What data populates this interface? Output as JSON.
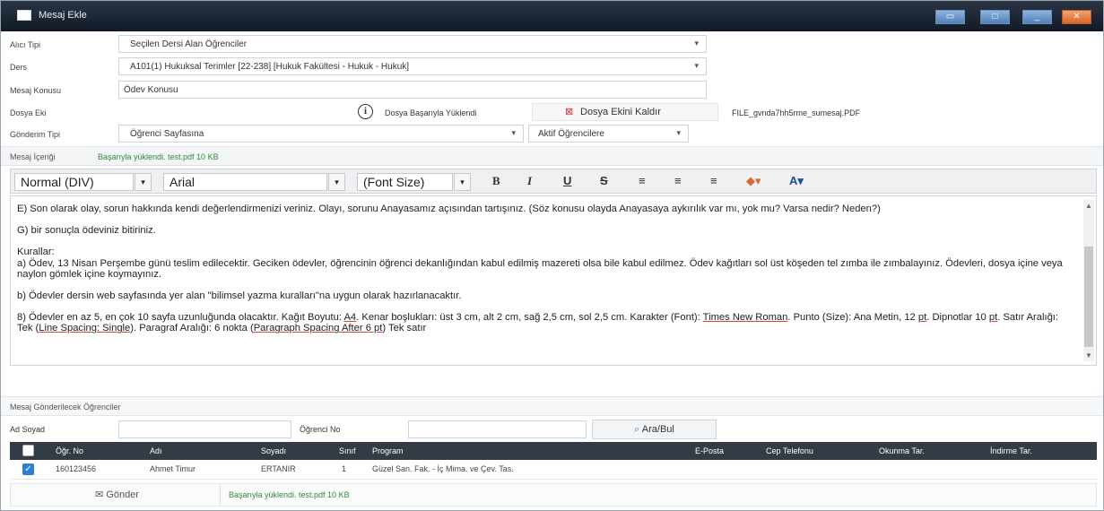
{
  "window": {
    "title": "Mesaj Ekle",
    "colors": {
      "titlebar": "#1b2533",
      "accent": "#2b7fd8",
      "success_text": "#2f8a3a",
      "grid_header": "#333b45"
    }
  },
  "form": {
    "alici_tipi": {
      "label": "Alıcı Tipi",
      "value": "Seçilen Dersi Alan Öğrenciler"
    },
    "ders": {
      "label": "Ders",
      "value": "A101(1) Hukuksal Terimler [22-238] [Hukuk Fakültesi - Hukuk - Hukuk]"
    },
    "konu": {
      "label": "Mesaj Konusu",
      "value": "Ödev Konusu"
    },
    "dosya": {
      "label": "Dosya Eki",
      "status": "Dosya Başarıyla Yüklendi",
      "remove_label": "Dosya Ekini Kaldır",
      "file_name": "FILE_gvnda7hh5rme_sumesaj.PDF"
    },
    "gonderim": {
      "label": "Gönderim Tipi",
      "value": "Öğrenci Sayfasına",
      "filter": "Aktif Öğrencilere"
    }
  },
  "message": {
    "label": "Mesaj İçeriği",
    "upload_status": "Başarıyla yüklendi. test.pdf 10 KB",
    "toolbar": {
      "format": "Normal (DIV)",
      "font": "Arial",
      "font_size": "(Font Size)",
      "bold": "B",
      "italic": "I",
      "underline": "U",
      "strike": "S"
    },
    "content": {
      "p1": "E) Son olarak olay, sorun hakkında kendi değerlendirmenizi veriniz. Olayı, sorunu Anayasamız açısından tartışınız. (Söz konusu olayda Anayasaya aykırılık var mı, yok mu? Varsa nedir? Neden?)",
      "p2": "G) bir sonuçla ödeviniz bitiriniz.",
      "p3_title": "Kurallar:",
      "p3": "a) Ödev, 13 Nisan Perşembe günü teslim edilecektir. Geciken ödevler, öğrencinin öğrenci dekanlığından kabul edilmiş mazereti olsa bile kabul edilmez. Ödev kağıtları sol üst köşeden tel zımba ile zımbalayınız. Ödevleri, dosya içine veya naylon gömlek içine koymayınız.",
      "p4": "b) Ödevler dersin web sayfasında yer alan \"bilimsel yazma kuralları\"na uygun olarak hazırlanacaktır.",
      "p5a": "8) Ödevler en az 5, en çok 10 sayfa uzunluğunda olacaktır. Kağıt Boyutu: ",
      "p5_a4": "A4",
      "p5b": ". Kenar boşlukları: üst 3 cm, alt 2 cm, sağ 2,5 cm, sol 2,5 cm. Karakter (Font): ",
      "p5_font": "Times New Roman",
      "p5c": ". Punto (Size): Ana Metin, 12 ",
      "p5_pt1": "pt",
      "p5d": ". Dipnotlar 10 ",
      "p5_pt2": "pt",
      "p5e": ". Satır Aralığı: Tek (",
      "p5_spacing": "Line Spacing: Single",
      "p5f": "). Paragraf Aralığı: 6 nokta (",
      "p5_para": "Paragraph Spacing After 6 pt",
      "p5g": ") Tek satır"
    }
  },
  "recipients": {
    "label": "Mesaj Gönderilecek Öğrenciler",
    "search": {
      "name_label": "Ad Soyad",
      "no_label": "Öğrenci No",
      "button": "Ara/Bul"
    },
    "columns": [
      "Öğr. No",
      "Adı",
      "Soyadı",
      "Sınıf",
      "Program",
      "E-Posta",
      "Cep Telefonu",
      "Okunma Tar.",
      "İndirme Tar."
    ],
    "rows": [
      {
        "no": "160123456",
        "ad": "Ahmet Timur",
        "soyad": "ERTANIR",
        "sinif": "1",
        "program": "Güzel San. Fak. - İç Mima. ve Çev. Tas.",
        "eposta": "",
        "tel": "",
        "okunma": "",
        "indirme": ""
      }
    ]
  },
  "footer": {
    "send_label": "Gönder",
    "status": "Başarıyla yüklendi. test.pdf 10 KB"
  }
}
